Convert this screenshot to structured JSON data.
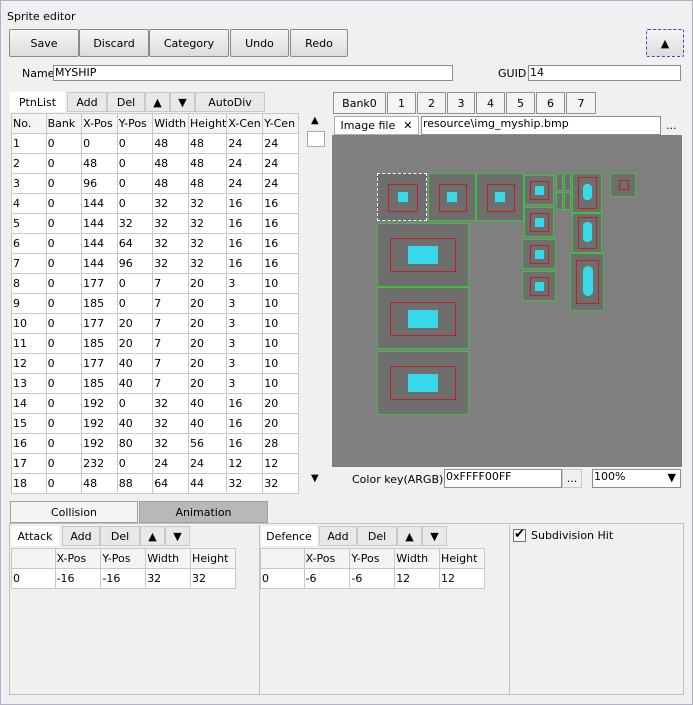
{
  "window": {
    "title": "Sprite editor"
  },
  "toolbar": {
    "save": "Save",
    "discard": "Discard",
    "category": "Category",
    "undo": "Undo",
    "redo": "Redo",
    "collapse": "▲"
  },
  "meta": {
    "name_label": "Name",
    "name_value": "MYSHIP",
    "guid_label": "GUID",
    "guid_value": "14"
  },
  "ptnlist": {
    "tab": "PtnList",
    "add": "Add",
    "del": "Del",
    "up": "▲",
    "down": "▼",
    "autodiv": "AutoDiv",
    "columns": [
      "No.",
      "Bank",
      "X-Pos",
      "Y-Pos",
      "Width",
      "Height",
      "X-Cen",
      "Y-Cen"
    ],
    "rows": [
      [
        "1",
        "0",
        "0",
        "0",
        "48",
        "48",
        "24",
        "24"
      ],
      [
        "2",
        "0",
        "48",
        "0",
        "48",
        "48",
        "24",
        "24"
      ],
      [
        "3",
        "0",
        "96",
        "0",
        "48",
        "48",
        "24",
        "24"
      ],
      [
        "4",
        "0",
        "144",
        "0",
        "32",
        "32",
        "16",
        "16"
      ],
      [
        "5",
        "0",
        "144",
        "32",
        "32",
        "32",
        "16",
        "16"
      ],
      [
        "6",
        "0",
        "144",
        "64",
        "32",
        "32",
        "16",
        "16"
      ],
      [
        "7",
        "0",
        "144",
        "96",
        "32",
        "32",
        "16",
        "16"
      ],
      [
        "8",
        "0",
        "177",
        "0",
        "7",
        "20",
        "3",
        "10"
      ],
      [
        "9",
        "0",
        "185",
        "0",
        "7",
        "20",
        "3",
        "10"
      ],
      [
        "10",
        "0",
        "177",
        "20",
        "7",
        "20",
        "3",
        "10"
      ],
      [
        "11",
        "0",
        "185",
        "20",
        "7",
        "20",
        "3",
        "10"
      ],
      [
        "12",
        "0",
        "177",
        "40",
        "7",
        "20",
        "3",
        "10"
      ],
      [
        "13",
        "0",
        "185",
        "40",
        "7",
        "20",
        "3",
        "10"
      ],
      [
        "14",
        "0",
        "192",
        "0",
        "32",
        "40",
        "16",
        "20"
      ],
      [
        "15",
        "0",
        "192",
        "40",
        "32",
        "40",
        "16",
        "20"
      ],
      [
        "16",
        "0",
        "192",
        "80",
        "32",
        "56",
        "16",
        "28"
      ],
      [
        "17",
        "0",
        "232",
        "0",
        "24",
        "24",
        "12",
        "12"
      ],
      [
        "18",
        "0",
        "48",
        "88",
        "64",
        "44",
        "32",
        "32"
      ]
    ]
  },
  "banks": [
    "Bank0",
    "1",
    "2",
    "3",
    "4",
    "5",
    "6",
    "7"
  ],
  "image": {
    "tab": "Image file",
    "close": "✕",
    "path": "resource\\img_myship.bmp",
    "browse": "...",
    "colorkey_label": "Color key(ARGB)",
    "colorkey_value": "0xFFFF00FF",
    "colorkey_browse": "...",
    "zoom": "100%",
    "zoom_arrow": "▼"
  },
  "bottom_tabs": {
    "collision": "Collision",
    "animation": "Animation"
  },
  "attack": {
    "tab": "Attack",
    "add": "Add",
    "del": "Del",
    "up": "▲",
    "down": "▼",
    "columns": [
      "",
      "X-Pos",
      "Y-Pos",
      "Width",
      "Height"
    ],
    "rows": [
      [
        "0",
        "-16",
        "-16",
        "32",
        "32"
      ]
    ]
  },
  "defence": {
    "tab": "Defence",
    "add": "Add",
    "del": "Del",
    "up": "▲",
    "down": "▼",
    "columns": [
      "",
      "X-Pos",
      "Y-Pos",
      "Width",
      "Height"
    ],
    "rows": [
      [
        "0",
        "-6",
        "-6",
        "12",
        "12"
      ]
    ]
  },
  "subdivision": {
    "label": "Subdivision Hit",
    "checked": true,
    "checkmark": "✔"
  },
  "scroll": {
    "up": "▲",
    "down": "▼"
  }
}
